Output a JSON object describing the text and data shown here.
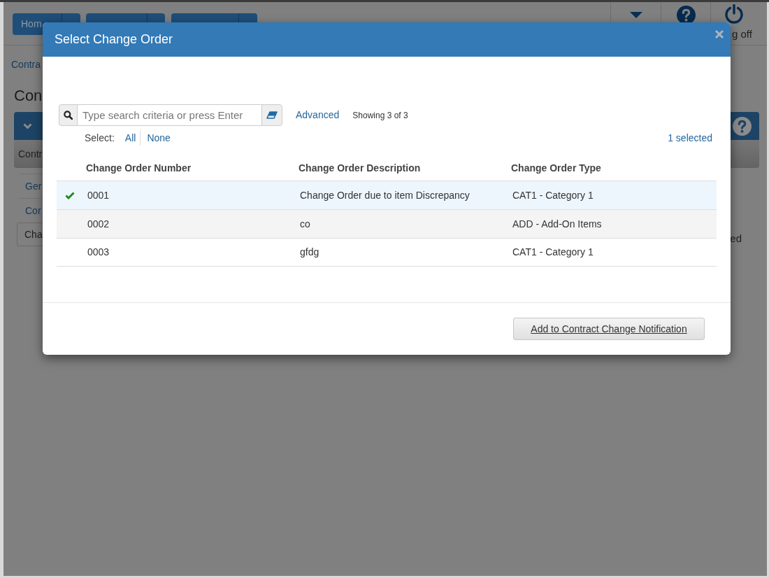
{
  "header": {
    "home_button": "Hom",
    "logoff_label": "g off"
  },
  "background": {
    "breadcrumb": "Contra",
    "heading": "Con",
    "column_header": "Contr",
    "links": [
      "Ger",
      "Cor"
    ],
    "tab": "Cha",
    "side_text": "ed"
  },
  "modal": {
    "title": "Select Change Order",
    "search": {
      "placeholder": "Type search criteria or press Enter"
    },
    "advanced_link": "Advanced",
    "result_count": "Showing 3 of 3",
    "select_label": "Select:",
    "select_options": [
      "All",
      "None"
    ],
    "selected_count": "1 selected",
    "table": {
      "columns": [
        "Change Order Number",
        "Change Order Description",
        "Change Order Type"
      ],
      "rows": [
        {
          "selected": true,
          "cells": [
            "0001",
            "Change Order due to item Discrepancy",
            "CAT1 - Category 1"
          ]
        },
        {
          "selected": false,
          "cells": [
            "0002",
            "co",
            "ADD - Add-On Items"
          ]
        },
        {
          "selected": false,
          "cells": [
            "0003",
            "gfdg",
            "CAT1 - Category 1"
          ]
        }
      ]
    },
    "action_button": "Add to Contract Change Notification"
  }
}
